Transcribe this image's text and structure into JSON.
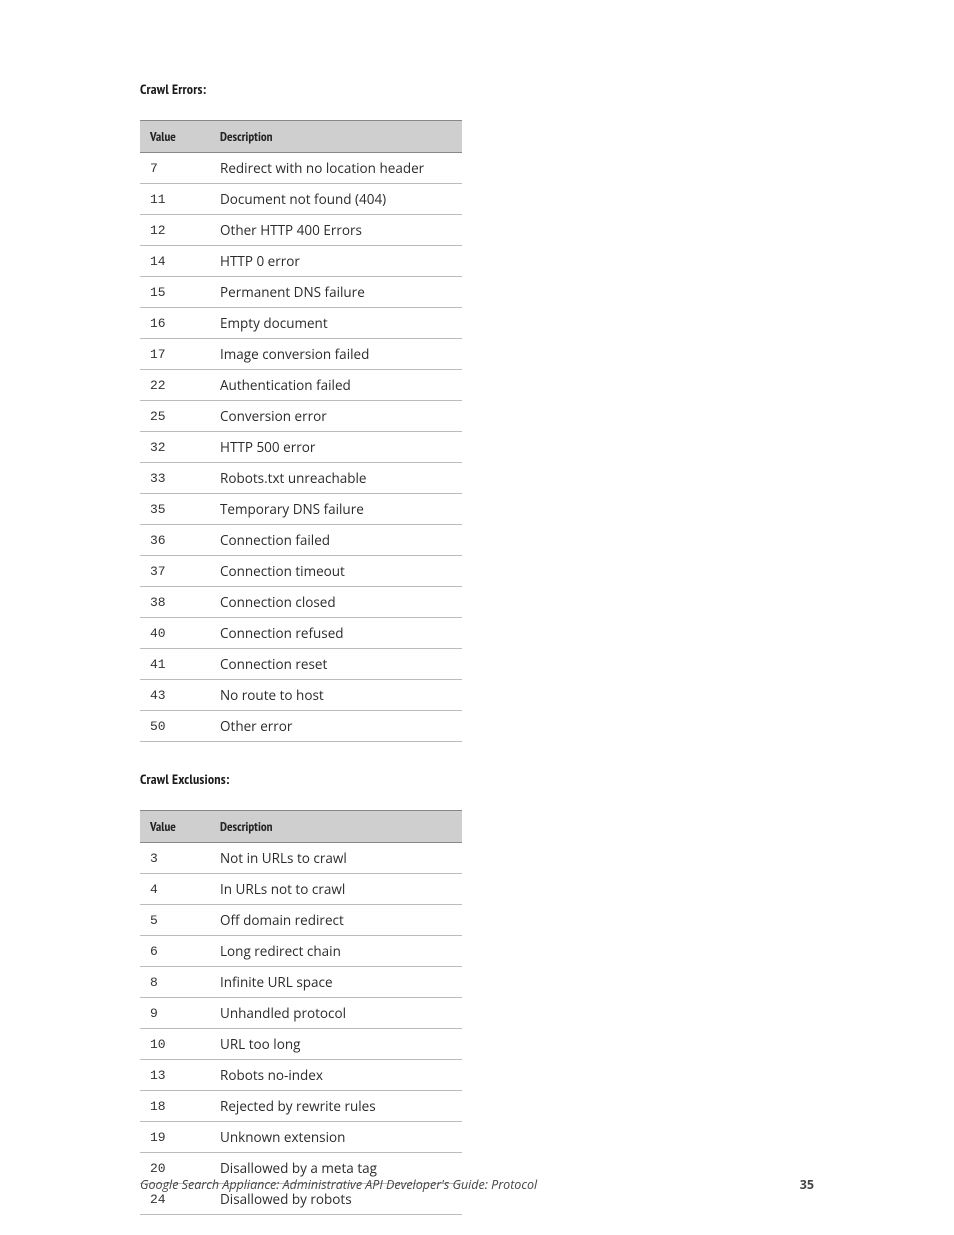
{
  "sections": [
    {
      "title": "Crawl Errors:",
      "headers": {
        "value": "Value",
        "description": "Description"
      },
      "rows": [
        {
          "value": "7",
          "description": "Redirect with no location header"
        },
        {
          "value": "11",
          "description": "Document not found (404)"
        },
        {
          "value": "12",
          "description": "Other HTTP 400 Errors"
        },
        {
          "value": "14",
          "description": "HTTP 0 error"
        },
        {
          "value": "15",
          "description": "Permanent DNS failure"
        },
        {
          "value": "16",
          "description": "Empty document"
        },
        {
          "value": "17",
          "description": "Image conversion failed"
        },
        {
          "value": "22",
          "description": "Authentication failed"
        },
        {
          "value": "25",
          "description": "Conversion error"
        },
        {
          "value": "32",
          "description": "HTTP 500 error"
        },
        {
          "value": "33",
          "description": "Robots.txt unreachable"
        },
        {
          "value": "35",
          "description": "Temporary DNS failure"
        },
        {
          "value": "36",
          "description": "Connection failed"
        },
        {
          "value": "37",
          "description": "Connection timeout"
        },
        {
          "value": "38",
          "description": "Connection closed"
        },
        {
          "value": "40",
          "description": "Connection refused"
        },
        {
          "value": "41",
          "description": "Connection reset"
        },
        {
          "value": "43",
          "description": "No route to host"
        },
        {
          "value": "50",
          "description": "Other error"
        }
      ]
    },
    {
      "title": "Crawl Exclusions:",
      "headers": {
        "value": "Value",
        "description": "Description"
      },
      "rows": [
        {
          "value": "3",
          "description": "Not in URLs to crawl"
        },
        {
          "value": "4",
          "description": "In URLs not to crawl"
        },
        {
          "value": "5",
          "description": "Off domain redirect"
        },
        {
          "value": "6",
          "description": "Long redirect chain"
        },
        {
          "value": "8",
          "description": "Infinite URL space"
        },
        {
          "value": "9",
          "description": "Unhandled protocol"
        },
        {
          "value": "10",
          "description": "URL too long"
        },
        {
          "value": "13",
          "description": "Robots no-index"
        },
        {
          "value": "18",
          "description": "Rejected by rewrite rules"
        },
        {
          "value": "19",
          "description": "Unknown extension"
        },
        {
          "value": "20",
          "description": "Disallowed by a meta tag"
        },
        {
          "value": "24",
          "description": "Disallowed by robots"
        }
      ]
    }
  ],
  "footer": {
    "title": "Google Search Appliance: Administrative API Developer's Guide: Protocol",
    "page": "35"
  }
}
